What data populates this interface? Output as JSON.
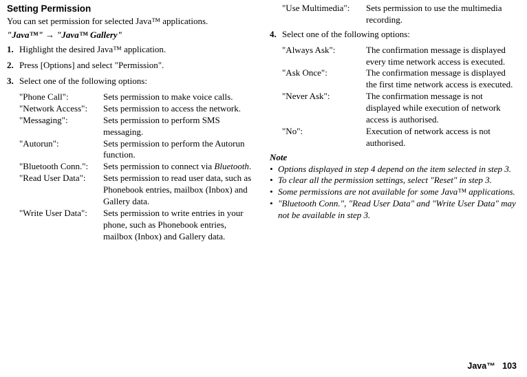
{
  "left": {
    "heading": "Setting Permission",
    "intro": "You can set permission for selected Java™ applications.",
    "breadcrumb_a": "\"Java™\"",
    "breadcrumb_arrow": " → ",
    "breadcrumb_b": "\"Java™ Gallery\"",
    "steps": [
      {
        "num": "1.",
        "text": "Highlight the desired Java™ application."
      },
      {
        "num": "2.",
        "text": "Press [Options] and select \"Permission\"."
      },
      {
        "num": "3.",
        "text": "Select one of the following options:"
      }
    ],
    "defs": [
      {
        "term": "\"Phone Call\":",
        "desc": "Sets permission to make voice calls."
      },
      {
        "term": "\"Network Access\":",
        "desc": "Sets permission to access the network."
      },
      {
        "term": "\"Messaging\":",
        "desc": "Sets permission to perform SMS messaging."
      },
      {
        "term": "\"Autorun\":",
        "desc": "Sets permission to perform the Autorun function."
      },
      {
        "term": "\"Bluetooth Conn.\":",
        "desc_pre": "Sets permission to connect via ",
        "desc_em": "Bluetooth",
        "desc_post": "."
      },
      {
        "term": "\"Read User Data\":",
        "desc": "Sets permission to read user data, such as Phonebook entries, mailbox (Inbox) and Gallery data."
      },
      {
        "term": "\"Write User Data\":",
        "desc": "Sets permission to write entries in your phone, such as Phonebook entries, mailbox (Inbox) and Gallery data."
      }
    ]
  },
  "right": {
    "topdefs": [
      {
        "term": "\"Use Multimedia\":",
        "desc": "Sets permission to use the multimedia recording."
      }
    ],
    "steps": [
      {
        "num": "4.",
        "text": "Select one of the following options:"
      }
    ],
    "defs": [
      {
        "term": "\"Always Ask\":",
        "desc": "The confirmation message is displayed every time network access is executed."
      },
      {
        "term": "\"Ask Once\":",
        "desc": "The confirmation message is displayed the first time network access is executed."
      },
      {
        "term": "\"Never Ask\":",
        "desc": "The confirmation message is not displayed while execution of network access is authorised."
      },
      {
        "term": "\"No\":",
        "desc": "Execution of network access is not authorised."
      }
    ],
    "note_hd": "Note",
    "notes": [
      "Options displayed in step 4 depend on the item selected in step 3.",
      "To clear all the permission settings, select \"Reset\" in step 3.",
      "Some permissions are not available for some Java™ applications.",
      "\"Bluetooth Conn.\", \"Read User Data\" and \"Write User Data\" may not be available in step 3."
    ]
  },
  "footer_label": "Java™",
  "footer_page": "103"
}
